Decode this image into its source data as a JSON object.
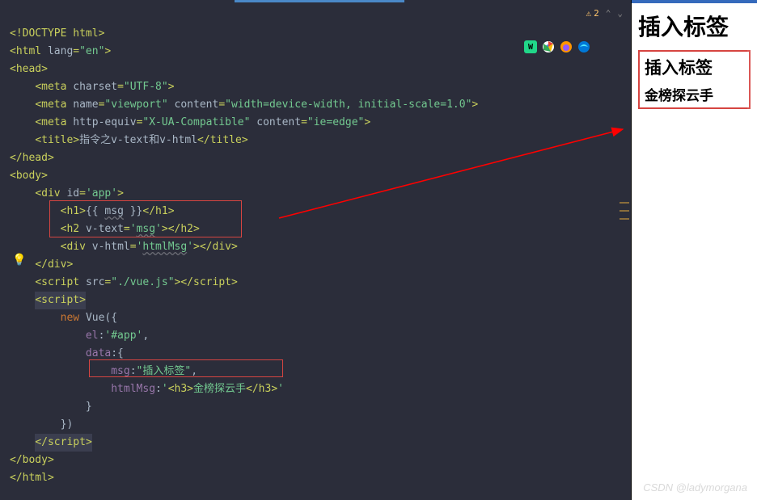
{
  "editor": {
    "warning": {
      "icon": "⚠",
      "count": "2"
    },
    "code": {
      "l1_doctype": "DOCTYPE html",
      "l2_tag": "html",
      "l2_attr": "lang",
      "l2_val": "\"en\"",
      "l3_tag": "head",
      "l4_tag": "meta",
      "l4_attr": "charset",
      "l4_val": "\"UTF-8\"",
      "l5_tag": "meta",
      "l5_attr1": "name",
      "l5_val1": "\"viewport\"",
      "l5_attr2": "content",
      "l5_val2": "\"width=device-width, initial-scale=1.0\"",
      "l6_tag": "meta",
      "l6_attr1": "http-equiv",
      "l6_val1": "\"X-UA-Compatible\"",
      "l6_attr2": "content",
      "l6_val2": "\"ie=edge\"",
      "l7_tag": "title",
      "l7_text": "指令之v-text和v-html",
      "l8_ctag": "head",
      "l9_tag": "body",
      "l10_tag": "div",
      "l10_attr": "id",
      "l10_val": "'app'",
      "l11_tag": "h1",
      "l11_text1": "{{ ",
      "l11_msg": "msg",
      "l11_text2": " }}",
      "l12_tag": "h2",
      "l12_attr": "v-text",
      "l12_val_q": "'",
      "l12_val": "msg",
      "l13_tag": "div",
      "l13_attr": "v-html",
      "l13_val_q": "'",
      "l13_val": "htmlMsg",
      "l14_ctag": "div",
      "l15_tag": "script",
      "l15_attr": "src",
      "l15_val": "\"./vue.js\"",
      "l16_tag": "script",
      "l17_new": "new ",
      "l17_vue": "Vue({",
      "l18_key": "el",
      "l18_val": "'#app'",
      "l19_key": "data",
      "l19_val": ":{",
      "l20_key": "msg",
      "l20_val": "\"插入标签\"",
      "l21_key": "htmlMsg",
      "l21_colon": ":",
      "l21_q": "'",
      "l21_tag": "h3",
      "l21_text": "金榜探云手",
      "l22": "}",
      "l23": "})",
      "l24_ctag": "script",
      "l25_ctag": "body",
      "l26_ctag": "html"
    }
  },
  "preview": {
    "h1": "插入标签",
    "h2": "插入标签",
    "h3": "金榜探云手"
  },
  "watermark": "CSDN @ladymorgana"
}
